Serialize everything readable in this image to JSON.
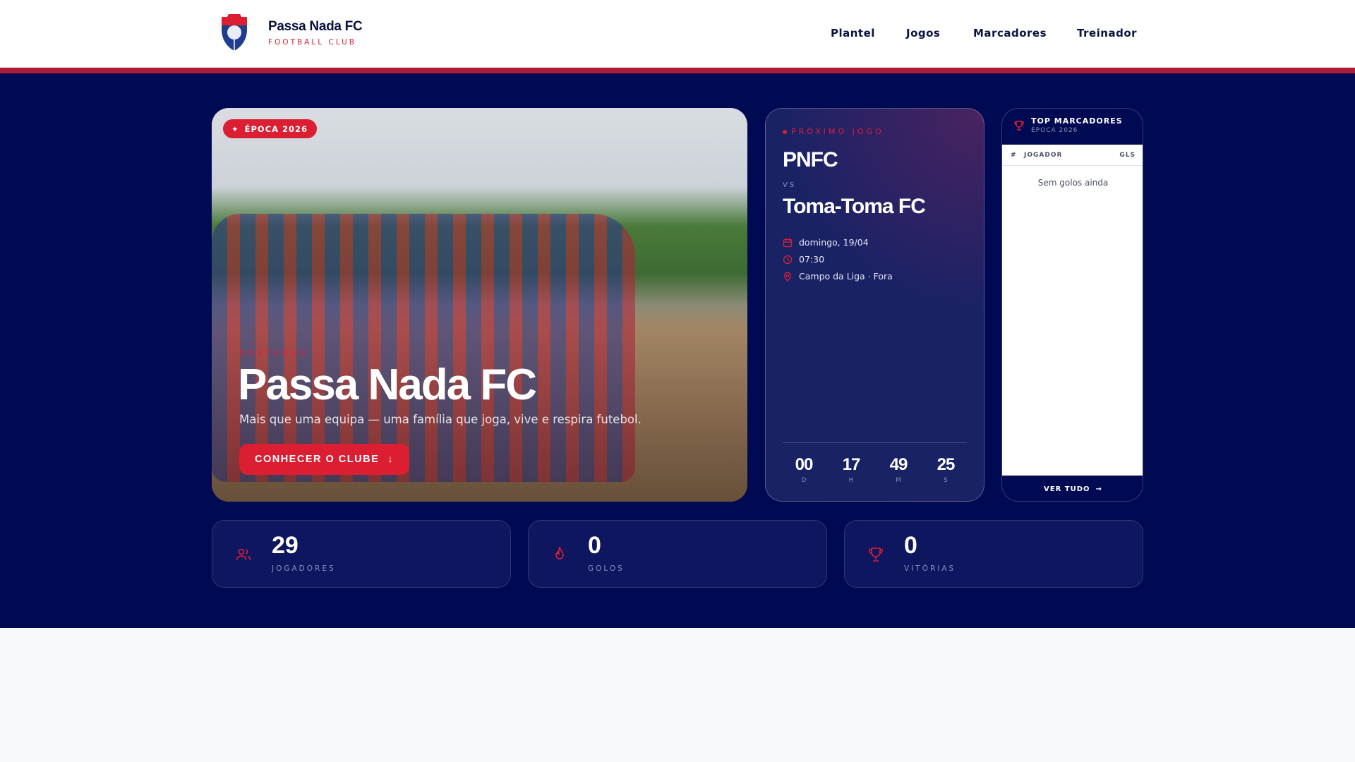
{
  "header": {
    "title": "Passa Nada FC",
    "subtitle": "FOOTBALL CLUB",
    "nav": [
      "Plantel",
      "Jogos",
      "Marcadores",
      "Treinador"
    ]
  },
  "hero": {
    "badge": "ÉPOCA 2026",
    "eyebrow": "DESTAQUE",
    "title": "Passa Nada FC",
    "subtitle": "Mais que uma equipa — uma família que joga, vive e respira futebol.",
    "cta": "CONHECER O CLUBE"
  },
  "match": {
    "label": "PRÓXIMO JOGO",
    "home": "PNFC",
    "vs": "VS",
    "away": "Toma-Toma FC",
    "date": "domingo, 19/04",
    "time": "07:30",
    "venue": "Campo da Liga · Fora",
    "countdown": [
      {
        "value": "00",
        "unit": "D"
      },
      {
        "value": "17",
        "unit": "H"
      },
      {
        "value": "49",
        "unit": "M"
      },
      {
        "value": "25",
        "unit": "S"
      }
    ]
  },
  "scorers": {
    "title": "TOP MARCADORES",
    "subtitle": "ÉPOCA 2026",
    "columns": [
      "#",
      "JOGADOR",
      "GLS"
    ],
    "empty": "Sem golos ainda",
    "more": "VER TUDO"
  },
  "stats": [
    {
      "value": "29",
      "label": "JOGADORES",
      "icon": "users-icon"
    },
    {
      "value": "0",
      "label": "GOLOS",
      "icon": "flame-icon"
    },
    {
      "value": "0",
      "label": "VITÓRIAS",
      "icon": "trophy-icon"
    }
  ],
  "colors": {
    "navy": "#000a52",
    "red": "#dc1e32",
    "stripe": "#b01c35"
  }
}
